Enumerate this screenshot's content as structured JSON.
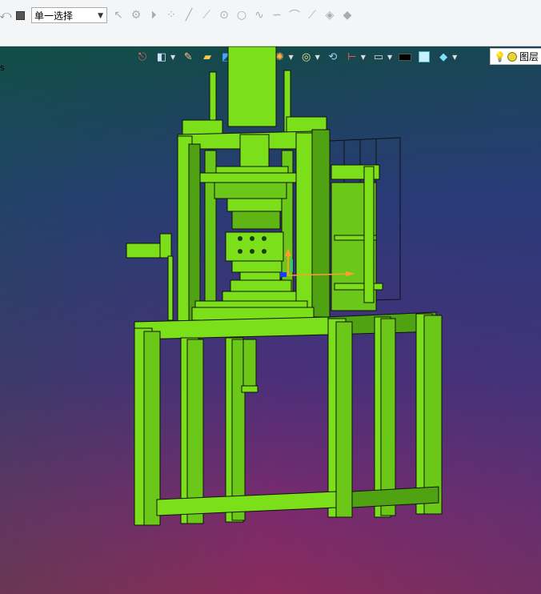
{
  "toolbar": {
    "selection_mode": {
      "value": "单一选择",
      "options_visible": [
        "单一选择"
      ]
    },
    "tools": [
      "undo-icon",
      "stop-icon",
      "pointer-icon",
      "gear-select-icon",
      "play-icon",
      "point-cloud-icon",
      "line-icon",
      "segment-icon",
      "circle-center-icon",
      "circle-icon",
      "spline-icon",
      "curve-icon",
      "arc-icon",
      "polyline-icon",
      "surface-icon",
      "solid-icon"
    ]
  },
  "viewport_toolbar": {
    "items": [
      "exit-icon",
      "view-orient-icon",
      "pen-icon",
      "section-icon",
      "display-cube-icon",
      "white-cube-icon",
      "render-icon",
      "appearance-icon",
      "rotate-icon",
      "measure-icon",
      "monitor-icon",
      "black-rect-icon",
      "cyan-square-icon",
      "layer-plane-icon"
    ],
    "layer_button": {
      "label": "图层"
    }
  },
  "viewport": {
    "background_top": "#144a4a",
    "background_mid": "#2a3a78",
    "background_bottom": "#8a2b5b",
    "model_color": "#7be01a",
    "model_shadow": "#4fa312",
    "edge_color": "#101010",
    "left_edge_text": "s"
  }
}
